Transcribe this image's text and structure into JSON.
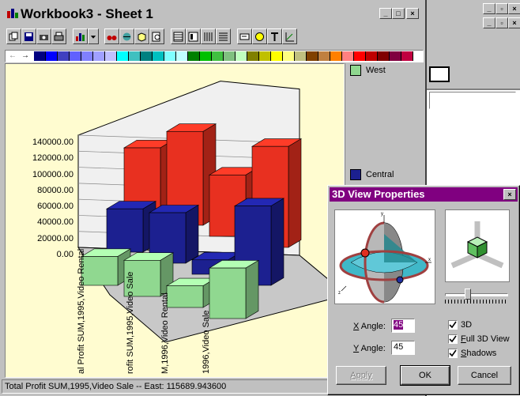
{
  "workbook": {
    "title": "Workbook3 - Sheet 1",
    "min_label": "_",
    "max_label": "□",
    "close_label": "×"
  },
  "background_window": {
    "min_label": "_",
    "restore_label": "▫",
    "close_label": "×"
  },
  "palette": {
    "colors": [
      "#000080",
      "#0000ff",
      "#4040c0",
      "#6060ff",
      "#8080ff",
      "#a0a0ff",
      "#c0c0ff",
      "#00ffff",
      "#40c0c0",
      "#008080",
      "#00c0c0",
      "#80ffff",
      "#c0ffff",
      "#008000",
      "#00c000",
      "#40c040",
      "#80c080",
      "#c0ffc0",
      "#808000",
      "#c0c000",
      "#ffff00",
      "#ffff80",
      "#c0c080",
      "#804000",
      "#c08040",
      "#ff8000",
      "#ff8080",
      "#ff0000",
      "#c00000",
      "#800000",
      "#800040",
      "#c00040"
    ]
  },
  "legend": {
    "items": [
      {
        "label": "West",
        "color": "#90d890"
      },
      {
        "label": "Central",
        "color": "#1c2090"
      }
    ]
  },
  "chart_data": {
    "type": "bar",
    "three_d": true,
    "yticks": [
      "140000.00",
      "120000.00",
      "100000.00",
      "80000.00",
      "60000.00",
      "40000.00",
      "20000.00",
      "0.00"
    ],
    "categories": [
      "al Profit SUM,1995,Video Rental",
      "rofit SUM,1995,Video Sale",
      "M,1996,Video Rental",
      "1996,Video Sale"
    ],
    "series": [
      {
        "name": "West",
        "color": "#90d890",
        "values": [
          40000,
          50000,
          30000,
          70000
        ]
      },
      {
        "name": "Central",
        "color": "#1c2090",
        "values": [
          60000,
          70000,
          20000,
          110000
        ]
      },
      {
        "name": "",
        "color": "#e83020",
        "values": [
          92000,
          130000,
          85000,
          140000
        ]
      }
    ],
    "ylim": [
      0,
      140000
    ],
    "grid": true
  },
  "status_bar": {
    "text": "Total Profit SUM,1995,Video Sale -- East: 115689.943600"
  },
  "dialog": {
    "title": "3D View Properties",
    "close_label": "×",
    "x_angle_label": "X Angle:",
    "x_angle_key": "X",
    "x_angle_rest": " Angle:",
    "x_angle_value": "45",
    "y_angle_key": "Y",
    "y_angle_rest": " Angle:",
    "y_angle_value": "45",
    "cb_3d_label": "3D",
    "cb_full_key": "F",
    "cb_full_rest": "ull 3D View",
    "cb_shadows_key": "S",
    "cb_shadows_rest": "hadows",
    "apply_label": "Apply",
    "ok_label": "OK",
    "cancel_label": "Cancel",
    "slider_value": 0.35,
    "checks": {
      "three_d": true,
      "full_view": true,
      "shadows": true
    }
  }
}
